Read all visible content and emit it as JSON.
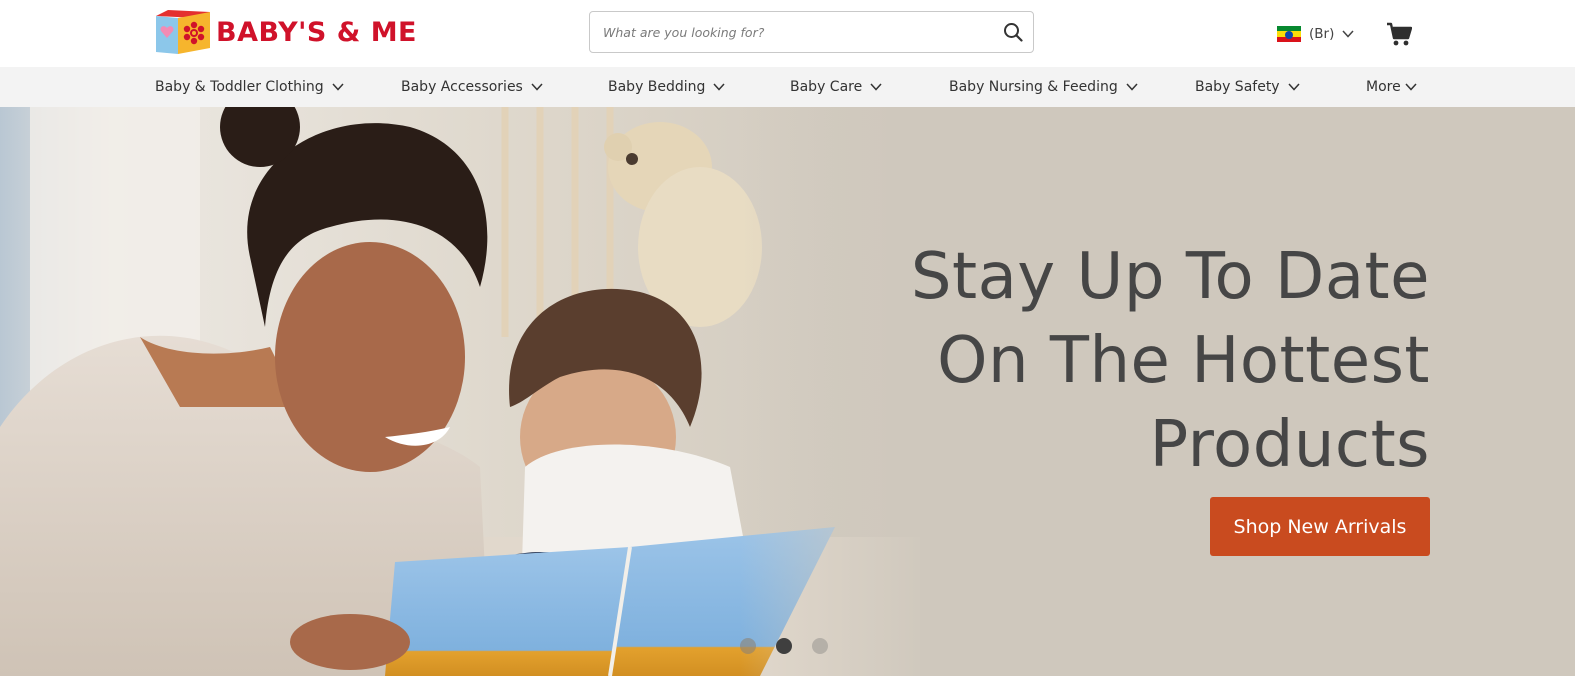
{
  "brand": {
    "name": "BABY'S & ME",
    "logo_icon": "toy-block-logo"
  },
  "search": {
    "placeholder": "What are you looking for?",
    "value": "",
    "icon": "search-icon"
  },
  "currency": {
    "label": "(Br)",
    "flag_icon": "ethiopia-flag-icon"
  },
  "cart": {
    "icon": "cart-icon"
  },
  "nav": {
    "items": [
      {
        "label": "Baby & Toddler Clothing"
      },
      {
        "label": "Baby Accessories"
      },
      {
        "label": "Baby Bedding"
      },
      {
        "label": "Baby Care"
      },
      {
        "label": "Baby Nursing & Feeding"
      },
      {
        "label": "Baby Safety"
      },
      {
        "label": "More"
      }
    ]
  },
  "hero": {
    "headline_lines": [
      "Stay Up To Date",
      "On The Hottest",
      "Products"
    ],
    "cta_label": "Shop New Arrivals",
    "slides_total": 3,
    "active_slide": 2
  },
  "colors": {
    "brand_red": "#d0122a",
    "cta_orange": "#c94b1f",
    "hero_bg": "#cfc8bd",
    "nav_bg": "#f3f3f3",
    "headline": "#464646"
  }
}
